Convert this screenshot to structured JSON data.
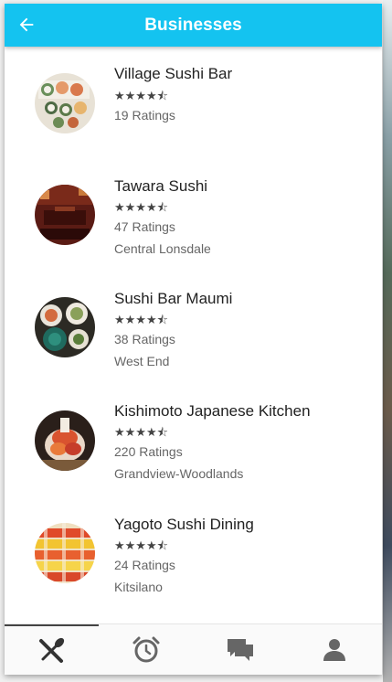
{
  "header": {
    "title": "Businesses",
    "back_icon": "arrow-left-icon",
    "background": "#14c3f0"
  },
  "businesses": [
    {
      "name": "Village Sushi Bar",
      "rating": 4.5,
      "stars": "★★★★⯪",
      "ratings": "19 Ratings",
      "neighborhood": ""
    },
    {
      "name": "Tawara Sushi",
      "rating": 4.5,
      "stars": "★★★★⯪",
      "ratings": "47 Ratings",
      "neighborhood": "Central Lonsdale"
    },
    {
      "name": "Sushi Bar Maumi",
      "rating": 4.5,
      "stars": "★★★★⯪",
      "ratings": "38 Ratings",
      "neighborhood": "West End"
    },
    {
      "name": "Kishimoto Japanese Kitchen",
      "rating": 4.5,
      "stars": "★★★★⯪",
      "ratings": "220 Ratings",
      "neighborhood": "Grandview-Woodlands"
    },
    {
      "name": "Yagoto Sushi Dining",
      "rating": 4.5,
      "stars": "★★★★⯪",
      "ratings": "24 Ratings",
      "neighborhood": "Kitsilano"
    }
  ],
  "bottom_nav": {
    "tabs": [
      {
        "icon": "fork-knife-icon",
        "active": true
      },
      {
        "icon": "alarm-clock-icon",
        "active": false
      },
      {
        "icon": "chat-bubbles-icon",
        "active": false
      },
      {
        "icon": "person-icon",
        "active": false
      }
    ]
  }
}
